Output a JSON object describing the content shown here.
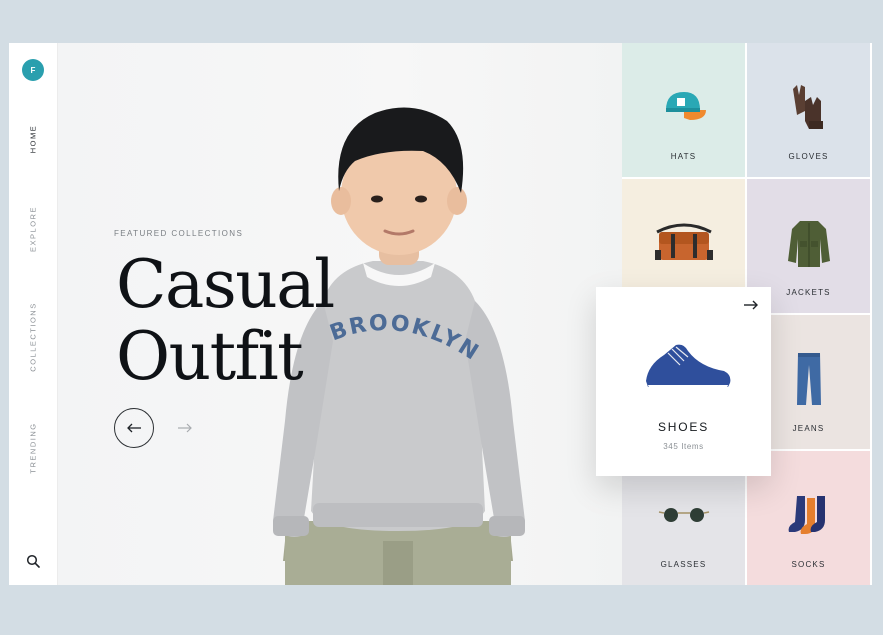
{
  "brand": {
    "logo_letter": "F",
    "accent": "#2a9fae"
  },
  "sidebar": {
    "items": [
      {
        "label": "HOME",
        "active": true
      },
      {
        "label": "EXPLORE",
        "active": false
      },
      {
        "label": "COLLECTIONS",
        "active": false
      },
      {
        "label": "TRENDING",
        "active": false
      }
    ],
    "search_icon": "search-icon"
  },
  "hero": {
    "kicker": "FEATURED COLLECTIONS",
    "title_line1": "Casual",
    "title_line2": "Outfit",
    "sweater_text": "BROOKLYN",
    "prev_icon": "arrow-left-icon",
    "next_icon": "arrow-right-icon"
  },
  "categories": [
    {
      "label": "HATS",
      "icon": "cap-icon",
      "bg": "#dcece8"
    },
    {
      "label": "GLOVES",
      "icon": "gloves-icon",
      "bg": "#dbe2ea"
    },
    {
      "label": "",
      "icon": "bag-icon",
      "bg": "#f5eee0"
    },
    {
      "label": "JACKETS",
      "icon": "jacket-icon",
      "bg": "#e2dde7"
    },
    {
      "label": "",
      "icon": "",
      "bg": "#e5e3df"
    },
    {
      "label": "JEANS",
      "icon": "jeans-icon",
      "bg": "#ebe4e1"
    },
    {
      "label": "GLASSES",
      "icon": "glasses-icon",
      "bg": "#e4e4e8"
    },
    {
      "label": "SOCKS",
      "icon": "socks-icon",
      "bg": "#f4dcdd"
    }
  ],
  "featured": {
    "label": "SHOES",
    "count": "345 Items",
    "icon": "shoe-icon",
    "arrow_icon": "arrow-right-icon"
  }
}
